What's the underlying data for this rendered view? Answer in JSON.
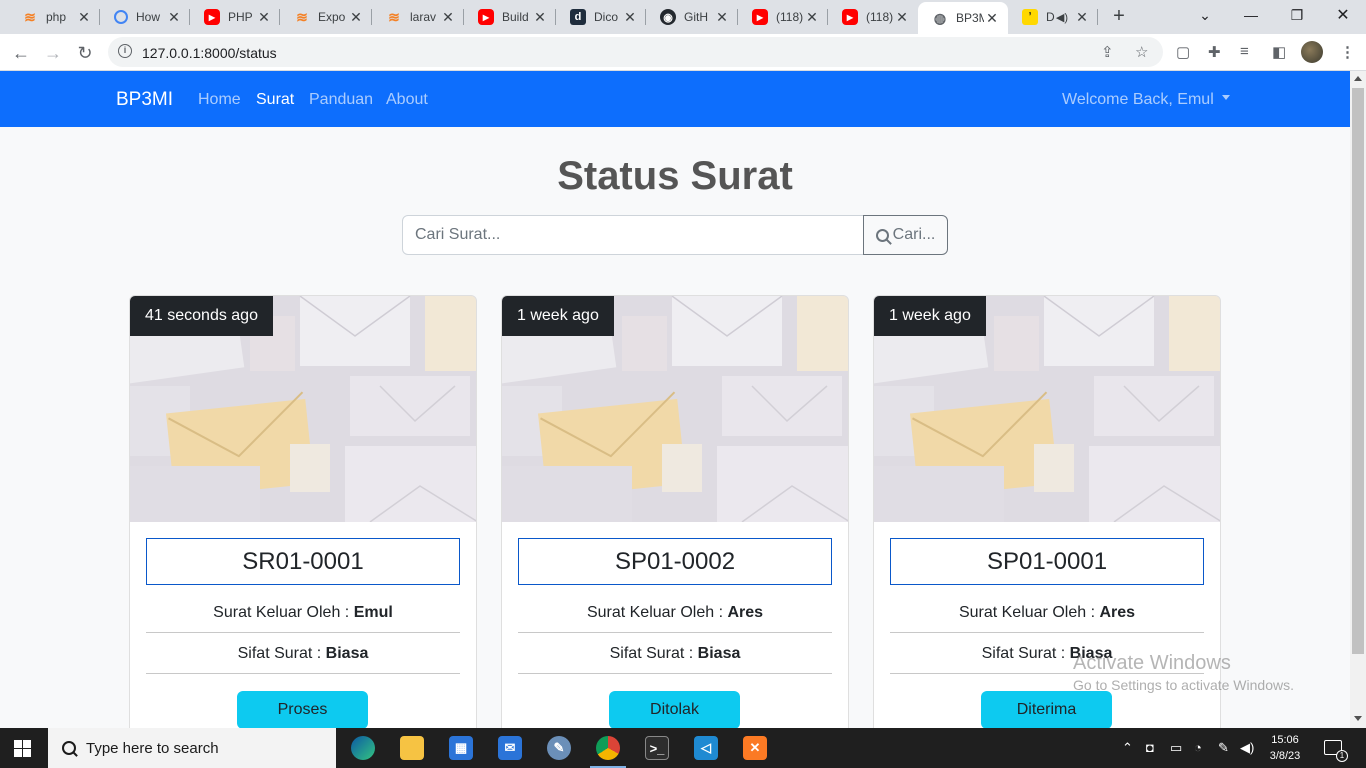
{
  "browser": {
    "tabs": [
      {
        "title": "php",
        "favicon": "so-icon"
      },
      {
        "title": "How",
        "favicon": "how-icon"
      },
      {
        "title": "PHP",
        "favicon": "youtube-icon"
      },
      {
        "title": "Expo",
        "favicon": "so-icon"
      },
      {
        "title": "larav",
        "favicon": "so-icon"
      },
      {
        "title": "Build",
        "favicon": "youtube-icon"
      },
      {
        "title": "Dico",
        "favicon": "dicoding-icon"
      },
      {
        "title": "GitH",
        "favicon": "github-icon"
      },
      {
        "title": "(118)",
        "favicon": "youtube-icon"
      },
      {
        "title": "(118)",
        "favicon": "youtube-icon"
      },
      {
        "title": "BP3M",
        "favicon": "globe-icon"
      },
      {
        "title": "D",
        "favicon": "app-icon"
      }
    ],
    "active_tab": 10,
    "url": "127.0.0.1:8000/status"
  },
  "navbar": {
    "brand": "BP3MI",
    "links": [
      "Home",
      "Surat",
      "Panduan",
      "About"
    ],
    "active_link": "Surat",
    "user_menu": "Welcome Back, Emul",
    "bg_color": "#0d6efd"
  },
  "page": {
    "title": "Status Surat",
    "search_placeholder": "Cari Surat...",
    "search_button": "Cari..."
  },
  "cards": [
    {
      "time_ago": "41 seconds ago",
      "code": "SR01-0001",
      "sender_label": "Surat Keluar Oleh :",
      "sender": "Emul",
      "nature_label": "Sifat Surat :",
      "nature": "Biasa",
      "status": "Proses"
    },
    {
      "time_ago": "1 week ago",
      "code": "SP01-0002",
      "sender_label": "Surat Keluar Oleh :",
      "sender": "Ares",
      "nature_label": "Sifat Surat :",
      "nature": "Biasa",
      "status": "Ditolak"
    },
    {
      "time_ago": "1 week ago",
      "code": "SP01-0001",
      "sender_label": "Surat Keluar Oleh :",
      "sender": "Ares",
      "nature_label": "Sifat Surat :",
      "nature": "Biasa",
      "status": "Diterima"
    }
  ],
  "watermark": {
    "line1": "Activate Windows",
    "line2": "Go to Settings to activate Windows."
  },
  "taskbar": {
    "search_placeholder": "Type here to search",
    "time": "15:06",
    "date": "3/8/23",
    "notification_count": "1"
  },
  "colors": {
    "status_button": "#0dcaf0",
    "badge_bg": "#212529"
  }
}
